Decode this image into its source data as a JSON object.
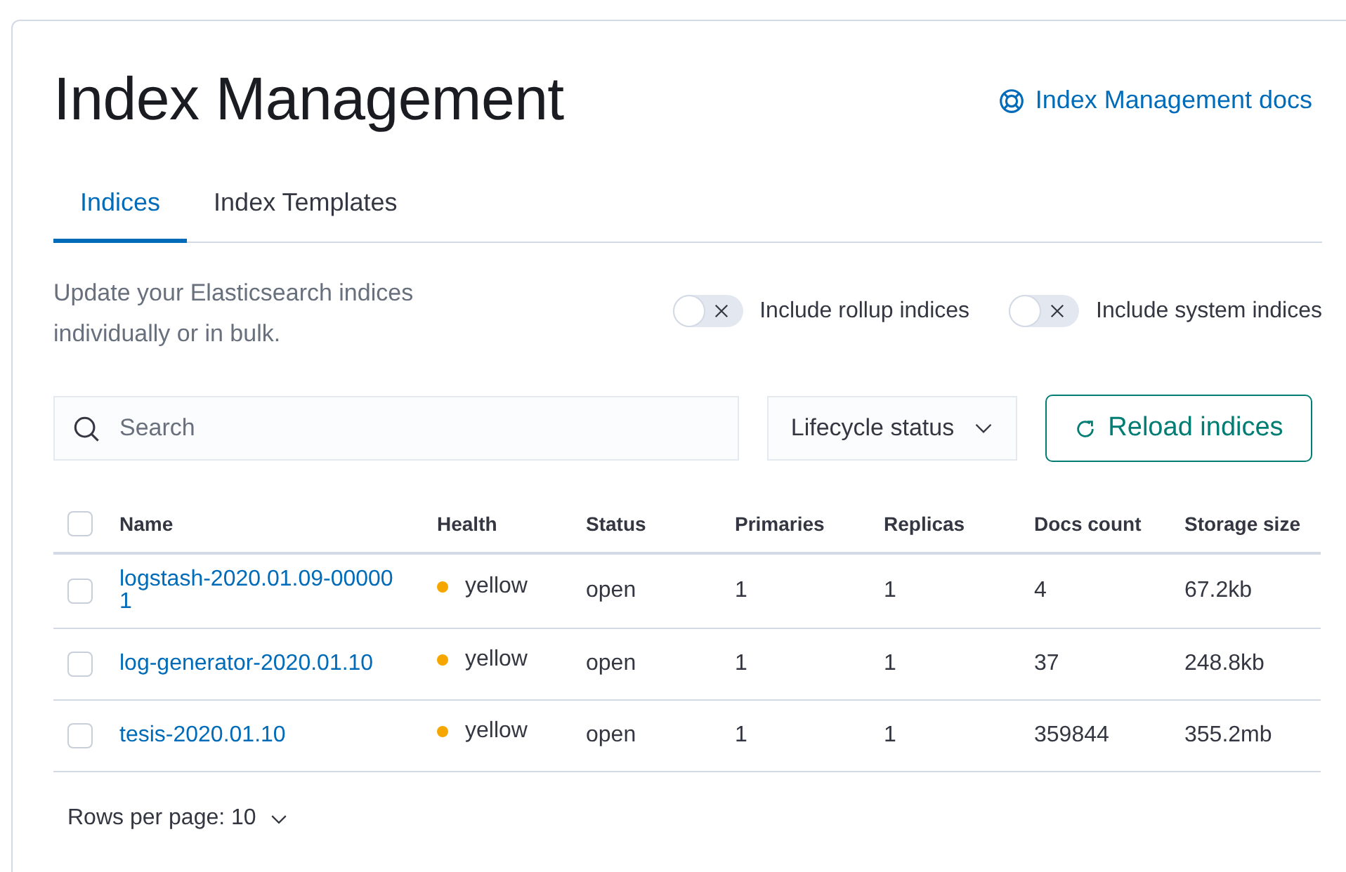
{
  "header": {
    "title": "Index Management",
    "docs_link": "Index Management docs"
  },
  "tabs": [
    {
      "label": "Indices",
      "selected": true
    },
    {
      "label": "Index Templates",
      "selected": false
    }
  ],
  "description": "Update your Elasticsearch indices individually or in bulk.",
  "toggles": [
    {
      "label": "Include rollup indices",
      "on": false
    },
    {
      "label": "Include system indices",
      "on": false
    }
  ],
  "search": {
    "placeholder": "Search"
  },
  "filter": {
    "label": "Lifecycle status"
  },
  "reload_button": {
    "label": "Reload indices"
  },
  "table": {
    "select_all_checked": false,
    "columns": [
      "Name",
      "Health",
      "Status",
      "Primaries",
      "Replicas",
      "Docs count",
      "Storage size"
    ],
    "rows": [
      {
        "checked": false,
        "name": "logstash-2020.01.09-000001",
        "health": "yellow",
        "color": "#f5a700",
        "status": "open",
        "primaries": "1",
        "replicas": "1",
        "docs_count": "4",
        "storage_size": "67.2kb"
      },
      {
        "checked": false,
        "name": "log-generator-2020.01.10",
        "health": "yellow",
        "color": "#f5a700",
        "status": "open",
        "primaries": "1",
        "replicas": "1",
        "docs_count": "37",
        "storage_size": "248.8kb"
      },
      {
        "checked": false,
        "name": "tesis-2020.01.10",
        "health": "yellow",
        "color": "#f5a700",
        "status": "open",
        "primaries": "1",
        "replicas": "1",
        "docs_count": "359844",
        "storage_size": "355.2mb"
      }
    ]
  },
  "pagination": {
    "label": "Rows per page: 10"
  }
}
